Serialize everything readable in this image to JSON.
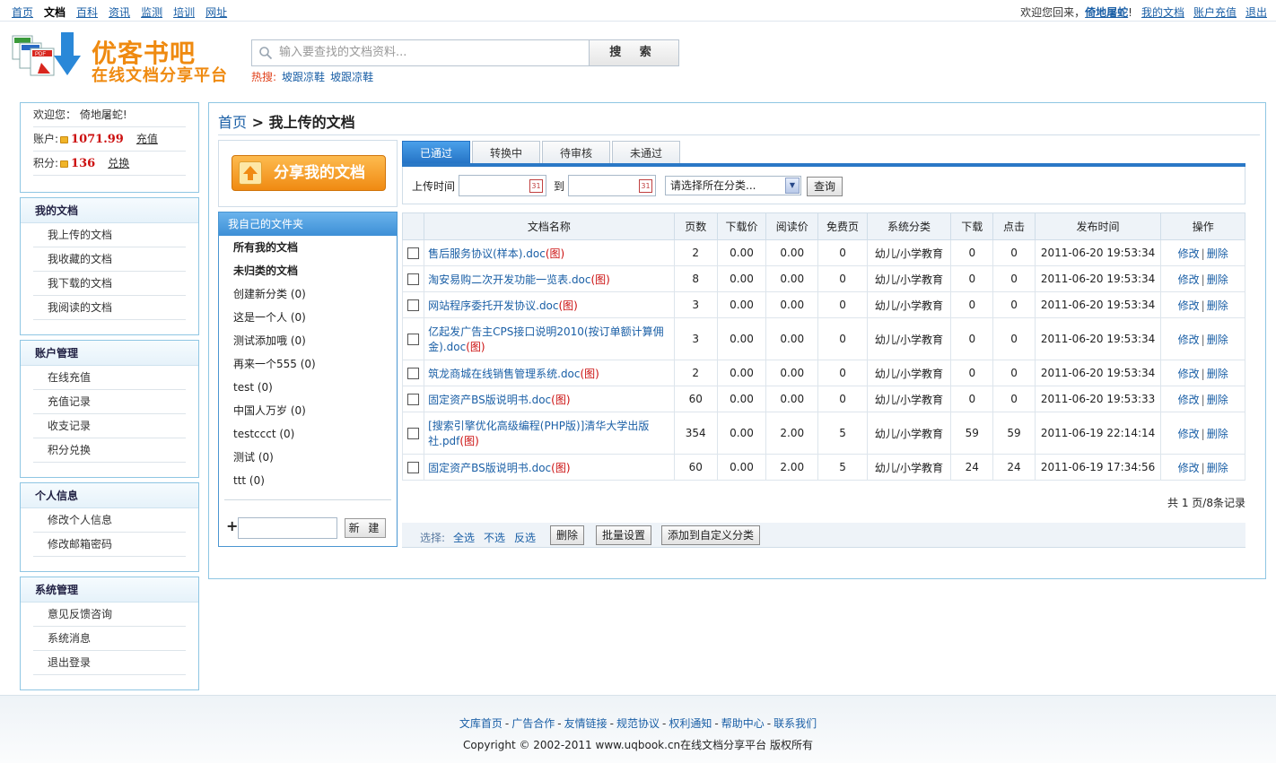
{
  "topnav": [
    "首页",
    "文档",
    "百科",
    "资讯",
    "监测",
    "培训",
    "网址"
  ],
  "user": {
    "welcome": "欢迎您回来，",
    "name": "倚地屠蛇",
    "mark": "!",
    "links": [
      "我的文档",
      "账户充值",
      "退出"
    ]
  },
  "logo": {
    "title": "优客书吧",
    "subtitle": "在线文档分享平台"
  },
  "search": {
    "placeholder": "输入要查找的文档资料...",
    "button": "搜 索",
    "hot_label": "热搜:",
    "hot": [
      "坡跟凉鞋",
      "坡跟凉鞋"
    ]
  },
  "sidebar": {
    "welcome_label": "欢迎您：",
    "welcome_name": "倚地屠蛇",
    "account_label": "账户:",
    "account_value": "1071.99",
    "account_link": "充值",
    "points_label": "积分:",
    "points_value": "136",
    "points_link": "兑换",
    "groups": [
      {
        "title": "我的文档",
        "items": [
          "我上传的文档",
          "我收藏的文档",
          "我下载的文档",
          "我阅读的文档"
        ]
      },
      {
        "title": "账户管理",
        "items": [
          "在线充值",
          "充值记录",
          "收支记录",
          "积分兑换"
        ]
      },
      {
        "title": "个人信息",
        "items": [
          "修改个人信息",
          "修改邮箱密码"
        ]
      },
      {
        "title": "系统管理",
        "items": [
          "意见反馈咨询",
          "系统消息",
          "退出登录"
        ]
      }
    ]
  },
  "breadcrumb": {
    "home": "首页",
    "sep": " > ",
    "current": "我上传的文档"
  },
  "share_button": "分享我的文档",
  "folders": {
    "title": "我自己的文件夹",
    "items": [
      {
        "label": "所有我的文档",
        "bold": true
      },
      {
        "label": "未归类的文档",
        "bold": true
      },
      {
        "label": "创建新分类 (0)"
      },
      {
        "label": "这是一个人 (0)"
      },
      {
        "label": "测试添加哦 (0)"
      },
      {
        "label": "再来一个555 (0)"
      },
      {
        "label": "test (0)"
      },
      {
        "label": "中国人万岁 (0)"
      },
      {
        "label": "testccct (0)"
      },
      {
        "label": "测试 (0)"
      },
      {
        "label": "ttt (0)"
      }
    ],
    "new_button": "新 建"
  },
  "tabs": [
    "已通过",
    "转换中",
    "待审核",
    "未通过"
  ],
  "filter": {
    "time_label": "上传时间",
    "to_label": "到",
    "category_placeholder": "请选择所在分类...",
    "query_button": "查询"
  },
  "table": {
    "headers": [
      "文档名称",
      "页数",
      "下载价",
      "阅读价",
      "免费页",
      "系统分类",
      "下载",
      "点击",
      "发布时间",
      "操作"
    ],
    "rows": [
      {
        "name": "售后服务协议(样本).doc",
        "pages": "2",
        "dl_price": "0.00",
        "read_price": "0.00",
        "free": "0",
        "cat": "幼儿/小学教育",
        "dl": "0",
        "clicks": "0",
        "time": "2011-06-20 19:53:34"
      },
      {
        "name": "淘安易购二次开发功能一览表.doc",
        "pages": "8",
        "dl_price": "0.00",
        "read_price": "0.00",
        "free": "0",
        "cat": "幼儿/小学教育",
        "dl": "0",
        "clicks": "0",
        "time": "2011-06-20 19:53:34"
      },
      {
        "name": "网站程序委托开发协议.doc",
        "pages": "3",
        "dl_price": "0.00",
        "read_price": "0.00",
        "free": "0",
        "cat": "幼儿/小学教育",
        "dl": "0",
        "clicks": "0",
        "time": "2011-06-20 19:53:34"
      },
      {
        "name": "亿起发广告主CPS接口说明2010(按订单额计算佣金).doc",
        "pages": "3",
        "dl_price": "0.00",
        "read_price": "0.00",
        "free": "0",
        "cat": "幼儿/小学教育",
        "dl": "0",
        "clicks": "0",
        "time": "2011-06-20 19:53:34",
        "tall": true
      },
      {
        "name": "筑龙商城在线销售管理系统.doc",
        "pages": "2",
        "dl_price": "0.00",
        "read_price": "0.00",
        "free": "0",
        "cat": "幼儿/小学教育",
        "dl": "0",
        "clicks": "0",
        "time": "2011-06-20 19:53:34"
      },
      {
        "name": "固定资产BS版说明书.doc",
        "pages": "60",
        "dl_price": "0.00",
        "read_price": "0.00",
        "free": "0",
        "cat": "幼儿/小学教育",
        "dl": "0",
        "clicks": "0",
        "time": "2011-06-20 19:53:33"
      },
      {
        "name": "[搜索引擎优化高级编程(PHP版)]清华大学出版社.pdf",
        "pages": "354",
        "dl_price": "0.00",
        "read_price": "2.00",
        "free": "5",
        "cat": "幼儿/小学教育",
        "dl": "59",
        "clicks": "59",
        "time": "2011-06-19 22:14:14",
        "tall": true
      },
      {
        "name": "固定资产BS版说明书.doc",
        "pages": "60",
        "dl_price": "0.00",
        "read_price": "2.00",
        "free": "5",
        "cat": "幼儿/小学教育",
        "dl": "24",
        "clicks": "24",
        "time": "2011-06-19 17:34:56"
      }
    ],
    "img_tag": "(图)",
    "op_edit": "修改",
    "op_delete": "删除"
  },
  "pager": "共 1 页/8条记录",
  "actions": {
    "label": "选择:",
    "select_all": "全选",
    "select_none": "不选",
    "invert": "反选",
    "delete": "删除",
    "batch": "批量设置",
    "add_custom": "添加到自定义分类"
  },
  "footer": {
    "links": [
      "文库首页",
      "广告合作",
      "友情链接",
      "规范协议",
      "权利通知",
      "帮助中心",
      "联系我们"
    ],
    "copyright": "Copyright © 2002-2011 www.uqbook.cn在线文档分享平台 版权所有"
  },
  "colors": {
    "accent_blue": "#2a78c6",
    "link_blue": "#1a5fa6",
    "orange": "#ef8a10",
    "red": "#cc1010"
  }
}
